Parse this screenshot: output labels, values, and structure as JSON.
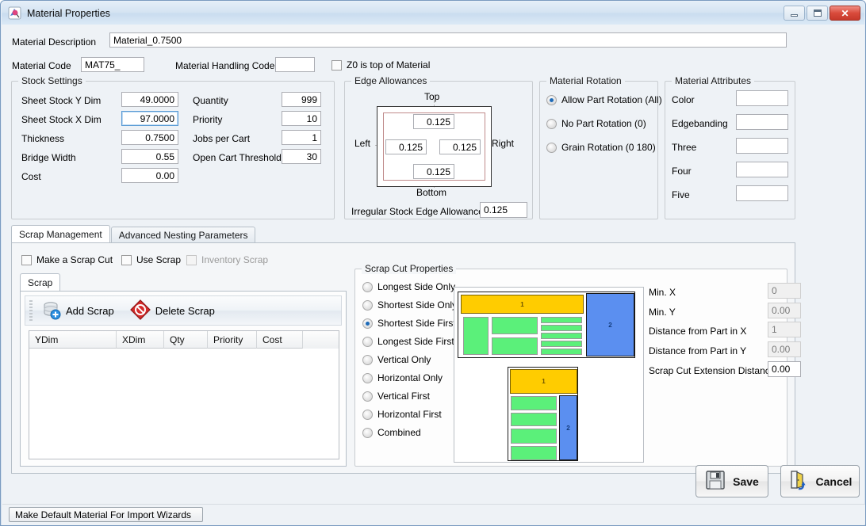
{
  "window": {
    "title": "Material Properties",
    "icon": "material-app-icon",
    "buttons": {
      "minimize": "minimize-icon",
      "maximize": "maximize-icon",
      "close": "✕"
    }
  },
  "header": {
    "material_description_label": "Material Description",
    "material_description_value": "Material_0.7500",
    "material_code_label": "Material Code",
    "material_code_value": "MAT75_",
    "material_handling_code_label": "Material Handling Code",
    "material_handling_code_value": "",
    "z0_top_label": "Z0 is top of Material",
    "z0_top_checked": false
  },
  "stock_settings": {
    "caption": "Stock Settings",
    "left": [
      {
        "label": "Sheet Stock Y Dim",
        "value": "49.0000",
        "focused": false
      },
      {
        "label": "Sheet Stock X Dim",
        "value": "97.0000",
        "focused": true
      },
      {
        "label": "Thickness",
        "value": "0.7500",
        "focused": false
      },
      {
        "label": "Bridge Width",
        "value": "0.55",
        "focused": false
      },
      {
        "label": "Cost",
        "value": "0.00",
        "focused": false
      }
    ],
    "right": [
      {
        "label": "Quantity",
        "value": "999"
      },
      {
        "label": "Priority",
        "value": "10"
      },
      {
        "label": "Jobs per Cart",
        "value": "1"
      },
      {
        "label": "Open Cart Threshold",
        "value": "30"
      }
    ]
  },
  "edge_allowances": {
    "caption": "Edge Allowances",
    "top_label": "Top",
    "bottom_label": "Bottom",
    "left_label": "Left",
    "right_label": "Right",
    "top_value": "0.125",
    "left_value": "0.125",
    "right_value": "0.125",
    "bottom_value": "0.125",
    "irregular_label": "Irregular Stock Edge Allowance",
    "irregular_value": "0.125"
  },
  "material_rotation": {
    "caption": "Material Rotation",
    "options": [
      {
        "label": "Allow Part Rotation (All)",
        "selected": true
      },
      {
        "label": "No Part Rotation (0)",
        "selected": false
      },
      {
        "label": "Grain Rotation (0 180)",
        "selected": false
      }
    ]
  },
  "material_attributes": {
    "caption": "Material Attributes",
    "fields": [
      {
        "label": "Color",
        "value": ""
      },
      {
        "label": "Edgebanding",
        "value": ""
      },
      {
        "label": "Three",
        "value": ""
      },
      {
        "label": "Four",
        "value": ""
      },
      {
        "label": "Five",
        "value": ""
      }
    ]
  },
  "main_tabs": [
    {
      "label": "Scrap Management",
      "active": true
    },
    {
      "label": "Advanced Nesting Parameters",
      "active": false
    }
  ],
  "scrap_management": {
    "checkboxes": [
      {
        "label": "Make a Scrap Cut",
        "checked": false,
        "disabled": false
      },
      {
        "label": "Use Scrap",
        "checked": false,
        "disabled": false
      },
      {
        "label": "Inventory Scrap",
        "checked": false,
        "disabled": true
      }
    ],
    "inner_tab": "Scrap",
    "toolbar": {
      "add_label": "Add Scrap",
      "add_icon": "database-add-icon",
      "delete_label": "Delete Scrap",
      "delete_icon": "delete-diamond-icon"
    },
    "grid": {
      "columns": [
        "YDim",
        "XDim",
        "Qty",
        "Priority",
        "Cost"
      ],
      "rows": []
    }
  },
  "scrap_cut_properties": {
    "caption": "Scrap Cut Properties",
    "options": [
      {
        "label": "Longest Side Only",
        "selected": false
      },
      {
        "label": "Shortest Side Only",
        "selected": false
      },
      {
        "label": "Shortest Side First",
        "selected": true
      },
      {
        "label": "Longest Side First",
        "selected": false
      },
      {
        "label": "Vertical Only",
        "selected": false
      },
      {
        "label": "Horizontal Only",
        "selected": false
      },
      {
        "label": "Vertical First",
        "selected": false
      },
      {
        "label": "Horizontal First",
        "selected": false
      },
      {
        "label": "Combined",
        "selected": false
      }
    ],
    "fields": [
      {
        "label": "Min. X",
        "value": "0",
        "disabled": true
      },
      {
        "label": "Min. Y",
        "value": "0.00",
        "disabled": true
      },
      {
        "label": "Distance from Part in X",
        "value": "1",
        "disabled": true
      },
      {
        "label": "Distance from Part in Y",
        "value": "0.00",
        "disabled": true
      },
      {
        "label": "Scrap Cut Extension Distance",
        "value": "0.00",
        "disabled": false
      }
    ],
    "preview": {
      "top_piece_label": "1",
      "side_piece_label": "2"
    }
  },
  "footer": {
    "save_label": "Save",
    "save_icon": "floppy-disk-icon",
    "cancel_label": "Cancel",
    "cancel_icon": "exit-door-icon",
    "default_material_label": "Make Default Material For Import Wizards"
  },
  "colors": {
    "accent": "#1e6bb8",
    "yellow_piece": "#ffcc00",
    "green_piece": "#5bf07a",
    "blue_piece": "#5b8ff0",
    "close_button": "#c6392b"
  }
}
